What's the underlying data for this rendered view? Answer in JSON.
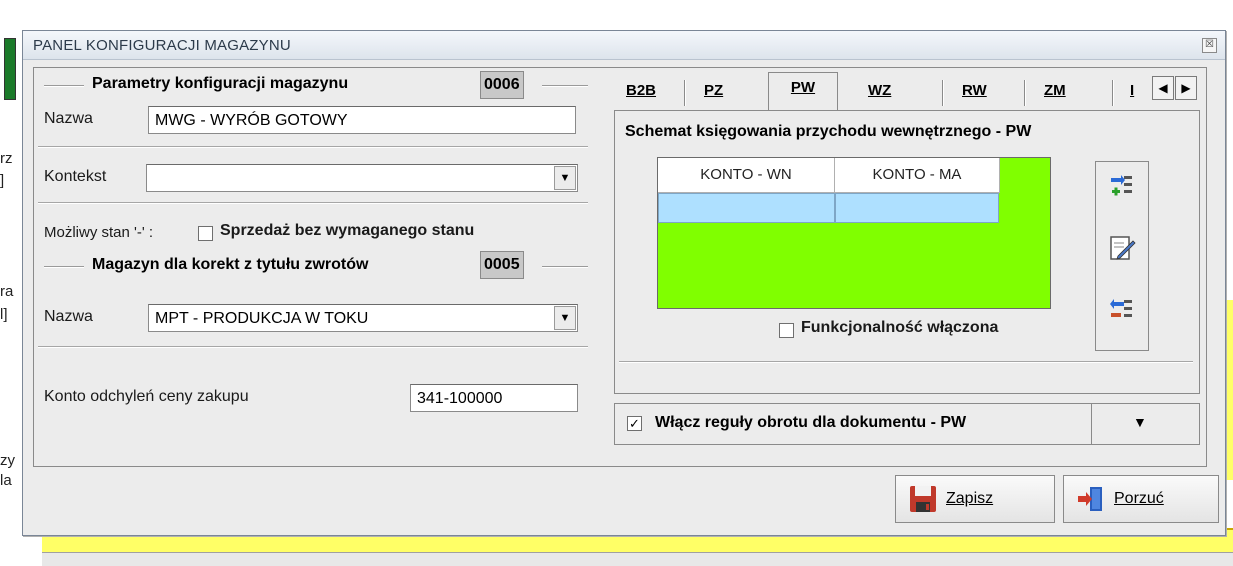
{
  "window": {
    "title": "PANEL KONFIGURACJI MAGAZYNU",
    "close_symbol": "☒"
  },
  "params": {
    "group_title": "Parametry konfiguracji  magazynu",
    "code": "0006",
    "name_label": "Nazwa",
    "name_value": "MWG - WYRÓB GOTOWY",
    "context_label": "Kontekst",
    "context_value": "",
    "possible_state_label": "Możliwy stan '-' :",
    "sale_without_stock_label": "Sprzedaż bez wymaganego stanu",
    "sale_without_stock_checked": false
  },
  "corrections": {
    "group_title": "Magazyn dla korekt z tytułu zwrotów",
    "code": "0005",
    "name_label": "Nazwa",
    "name_value": "MPT - PRODUKCJA W TOKU"
  },
  "price_deviation": {
    "label": "Konto odchyleń  ceny  zakupu",
    "value": "341-100000"
  },
  "tabs": [
    {
      "label": "B2B",
      "active": false
    },
    {
      "label": "PZ",
      "active": false
    },
    {
      "label": "PW",
      "active": true
    },
    {
      "label": "WZ",
      "active": false
    },
    {
      "label": "RW",
      "active": false
    },
    {
      "label": "ZM",
      "active": false
    },
    {
      "label": "I",
      "active": false
    }
  ],
  "pw_panel": {
    "title": "Schemat księgowania przychodu wewnętrznego - PW",
    "columns": [
      "KONTO - WN",
      "KONTO - MA"
    ],
    "functionality_label": "Funkcjonalność włączona",
    "functionality_checked": false,
    "grid_bg_color": "#80ff00",
    "toolbar_icons": [
      "add-row-icon",
      "edit-icon",
      "remove-row-icon"
    ]
  },
  "rules": {
    "label": "Włącz reguły obrotu dla dokumentu - PW",
    "checked": true
  },
  "buttons": {
    "save_label": "Zapisz",
    "cancel_label": "Porzuć"
  },
  "background": {
    "left_fragments": [
      "rz",
      "]",
      "ra",
      "l]",
      "zy",
      "la"
    ]
  }
}
